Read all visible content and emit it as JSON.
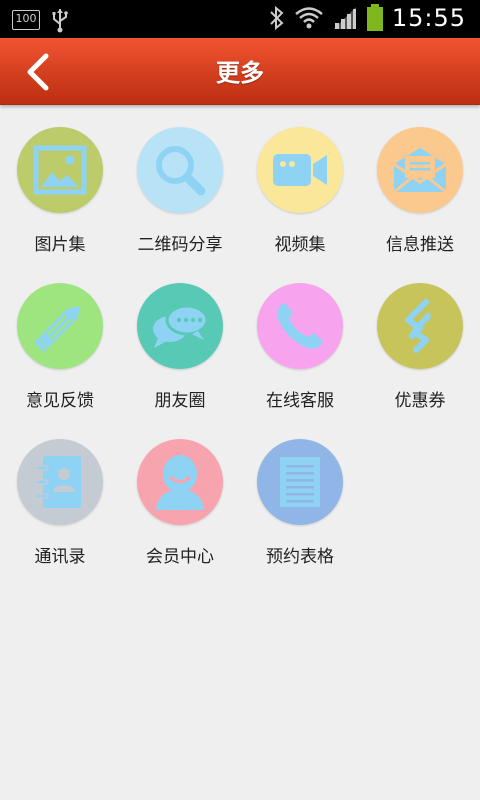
{
  "status_bar": {
    "battery_text": "100",
    "time": "15:55"
  },
  "header": {
    "title": "更多"
  },
  "colors": {
    "header_top": "#f35433",
    "header_bottom": "#bf2e12",
    "icon_fg": "#8fd3f4",
    "background": "#efefef"
  },
  "menu": {
    "items": [
      {
        "label": "图片集",
        "icon": "picture-icon",
        "color": "#bccc6a"
      },
      {
        "label": "二维码分享",
        "icon": "magnifier-icon",
        "color": "#b8e3f7"
      },
      {
        "label": "视频集",
        "icon": "video-camera-icon",
        "color": "#fbe79a"
      },
      {
        "label": "信息推送",
        "icon": "envelope-icon",
        "color": "#fbc88e"
      },
      {
        "label": "意见反馈",
        "icon": "pencil-icon",
        "color": "#9ee57f"
      },
      {
        "label": "朋友圈",
        "icon": "chat-bubbles-icon",
        "color": "#58c9b4"
      },
      {
        "label": "在线客服",
        "icon": "phone-icon",
        "color": "#f8a3ee"
      },
      {
        "label": "优惠券",
        "icon": "coupon-icon",
        "color": "#c6c45a"
      },
      {
        "label": "通讯录",
        "icon": "contact-book-icon",
        "color": "#c5cbd3"
      },
      {
        "label": "会员中心",
        "icon": "member-icon",
        "color": "#f8a4ae"
      },
      {
        "label": "预约表格",
        "icon": "form-icon",
        "color": "#8fb6e6"
      }
    ]
  }
}
